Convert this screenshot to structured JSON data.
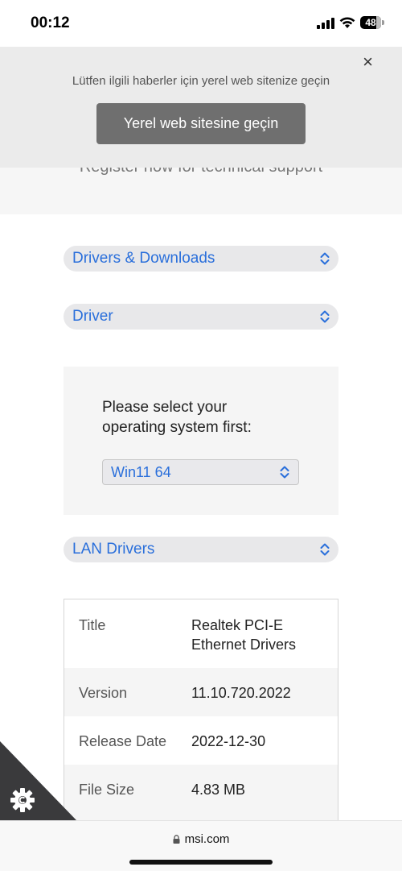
{
  "status_bar": {
    "time": "00:12",
    "battery": "48",
    "battery_level": 0.48
  },
  "locale_banner": {
    "message": "Lütfen ilgili haberler için yerel web sitenize geçin",
    "button_label": "Yerel web sitesine geçin",
    "close_glyph": "×"
  },
  "hero": {
    "text": "Register now for technical support"
  },
  "selects": {
    "category": "Drivers & Downloads",
    "subcategory": "Driver",
    "driver_type": "LAN Drivers"
  },
  "os_panel": {
    "prompt": "Please select your operating system first:",
    "selected_os": "Win11 64"
  },
  "details": {
    "rows": [
      {
        "label": "Title",
        "value": "Realtek PCI-E Ethernet Drivers"
      },
      {
        "label": "Version",
        "value": "11.10.720.2022"
      },
      {
        "label": "Release Date",
        "value": "2022-12-30"
      },
      {
        "label": "File Size",
        "value": "4.83 MB"
      }
    ]
  },
  "browser": {
    "url": "msi.com"
  },
  "icons": {
    "chevron": "chevron-up-down-icon",
    "gear": "gear-icon",
    "lock": "lock-icon",
    "close": "close-icon"
  },
  "colors": {
    "link_blue": "#2a6fdb",
    "banner_bg": "#ebebeb",
    "button_bg": "#6f6f6f"
  }
}
